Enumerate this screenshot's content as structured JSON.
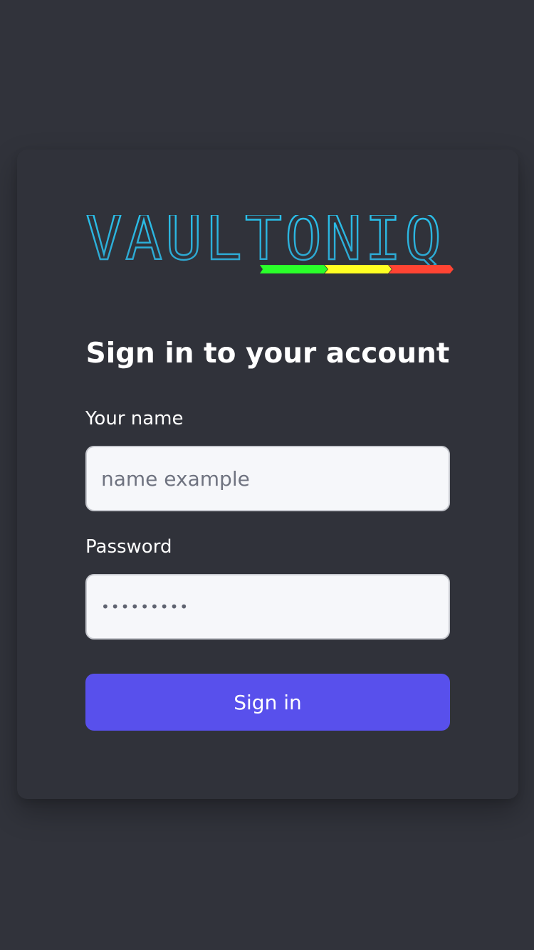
{
  "brand": {
    "logo_text": "VAULTONIQ",
    "accent_colors": [
      "#2aff2a",
      "#ffff22",
      "#ff4433"
    ],
    "logo_outline_color": "#2ec5ee"
  },
  "form": {
    "title": "Sign in to your account",
    "name_label": "Your name",
    "name_placeholder": "name example",
    "password_label": "Password",
    "password_value": "•••••••••",
    "submit_label": "Sign in"
  },
  "colors": {
    "background": "#31333b",
    "card": "#30323a",
    "button": "#5850ec",
    "input_background": "#f6f7fa"
  }
}
